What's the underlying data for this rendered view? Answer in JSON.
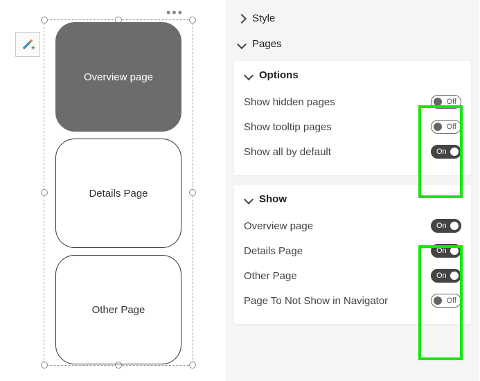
{
  "canvas": {
    "cards": [
      {
        "label": "Overview page",
        "active": true
      },
      {
        "label": "Details Page",
        "active": false
      },
      {
        "label": "Other Page",
        "active": false
      }
    ]
  },
  "panel": {
    "style_header": "Style",
    "pages_header": "Pages",
    "options": {
      "header": "Options",
      "rows": [
        {
          "label": "Show hidden pages",
          "state": "off",
          "text": "Off"
        },
        {
          "label": "Show tooltip pages",
          "state": "off",
          "text": "Off"
        },
        {
          "label": "Show all by default",
          "state": "on",
          "text": "On"
        }
      ]
    },
    "show": {
      "header": "Show",
      "rows": [
        {
          "label": "Overview page",
          "state": "on",
          "text": "On"
        },
        {
          "label": "Details Page",
          "state": "on",
          "text": "On"
        },
        {
          "label": "Other Page",
          "state": "on",
          "text": "On"
        },
        {
          "label": "Page To Not Show in Navigator",
          "state": "off",
          "text": "Off"
        }
      ]
    }
  }
}
